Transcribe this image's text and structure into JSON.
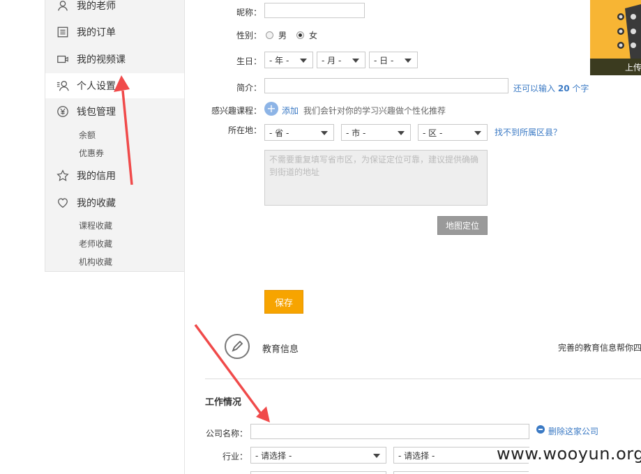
{
  "sidebar": {
    "items": [
      {
        "label": "我的老师",
        "icon": "user-icon"
      },
      {
        "label": "我的订单",
        "icon": "list-icon"
      },
      {
        "label": "我的视频课",
        "icon": "video-icon"
      },
      {
        "label": "个人设置",
        "icon": "user-settings-icon",
        "active": true
      },
      {
        "label": "钱包管理",
        "icon": "yen-icon"
      },
      {
        "label": "我的信用",
        "icon": "star-icon"
      },
      {
        "label": "我的收藏",
        "icon": "heart-icon"
      }
    ],
    "wallet_sub": [
      "余额",
      "优惠券"
    ],
    "fav_sub": [
      "课程收藏",
      "老师收藏",
      "机构收藏"
    ]
  },
  "form": {
    "nickname_label": "昵称：",
    "gender_label": "性别：",
    "gender_male": "男",
    "gender_female": "女",
    "birthday_label": "生日：",
    "birthday_year": "- 年 -",
    "birthday_month": "- 月 -",
    "birthday_day": "- 日 -",
    "intro_label": "简介：",
    "intro_hint_prefix": "还可以输入",
    "intro_hint_count": "20",
    "intro_hint_suffix": "个字",
    "interest_label": "感兴趣课程：",
    "interest_add": "添加",
    "interest_hint": "我们会针对你的学习兴趣做个性化推荐",
    "location_label": "所在地：",
    "province": "- 省 -",
    "city": "- 市 -",
    "district": "- 区 -",
    "location_missing": "找不到所属区县？",
    "address_placeholder_1": "不需要重复填写省市区，为保证定位可靠，建议提供确确",
    "address_placeholder_2": "到街道的地址",
    "map_button": "地图定位",
    "save_button": "保存"
  },
  "education": {
    "title": "教育信息",
    "hint": "完善的教育信息帮你四"
  },
  "work": {
    "title": "工作情况",
    "company_label": "公司名称：",
    "delete_company": "删除这家公司",
    "industry_label": "行业：",
    "industry_select_1": "- 请选择 -",
    "industry_select_2": "- 请选择 -"
  },
  "avatar": {
    "upload_label": "上传"
  },
  "watermark": "www.wooyun.org",
  "colors": {
    "accent_orange": "#f7a400",
    "link_blue": "#3a79c4",
    "arrow_red": "#f04a4a"
  }
}
